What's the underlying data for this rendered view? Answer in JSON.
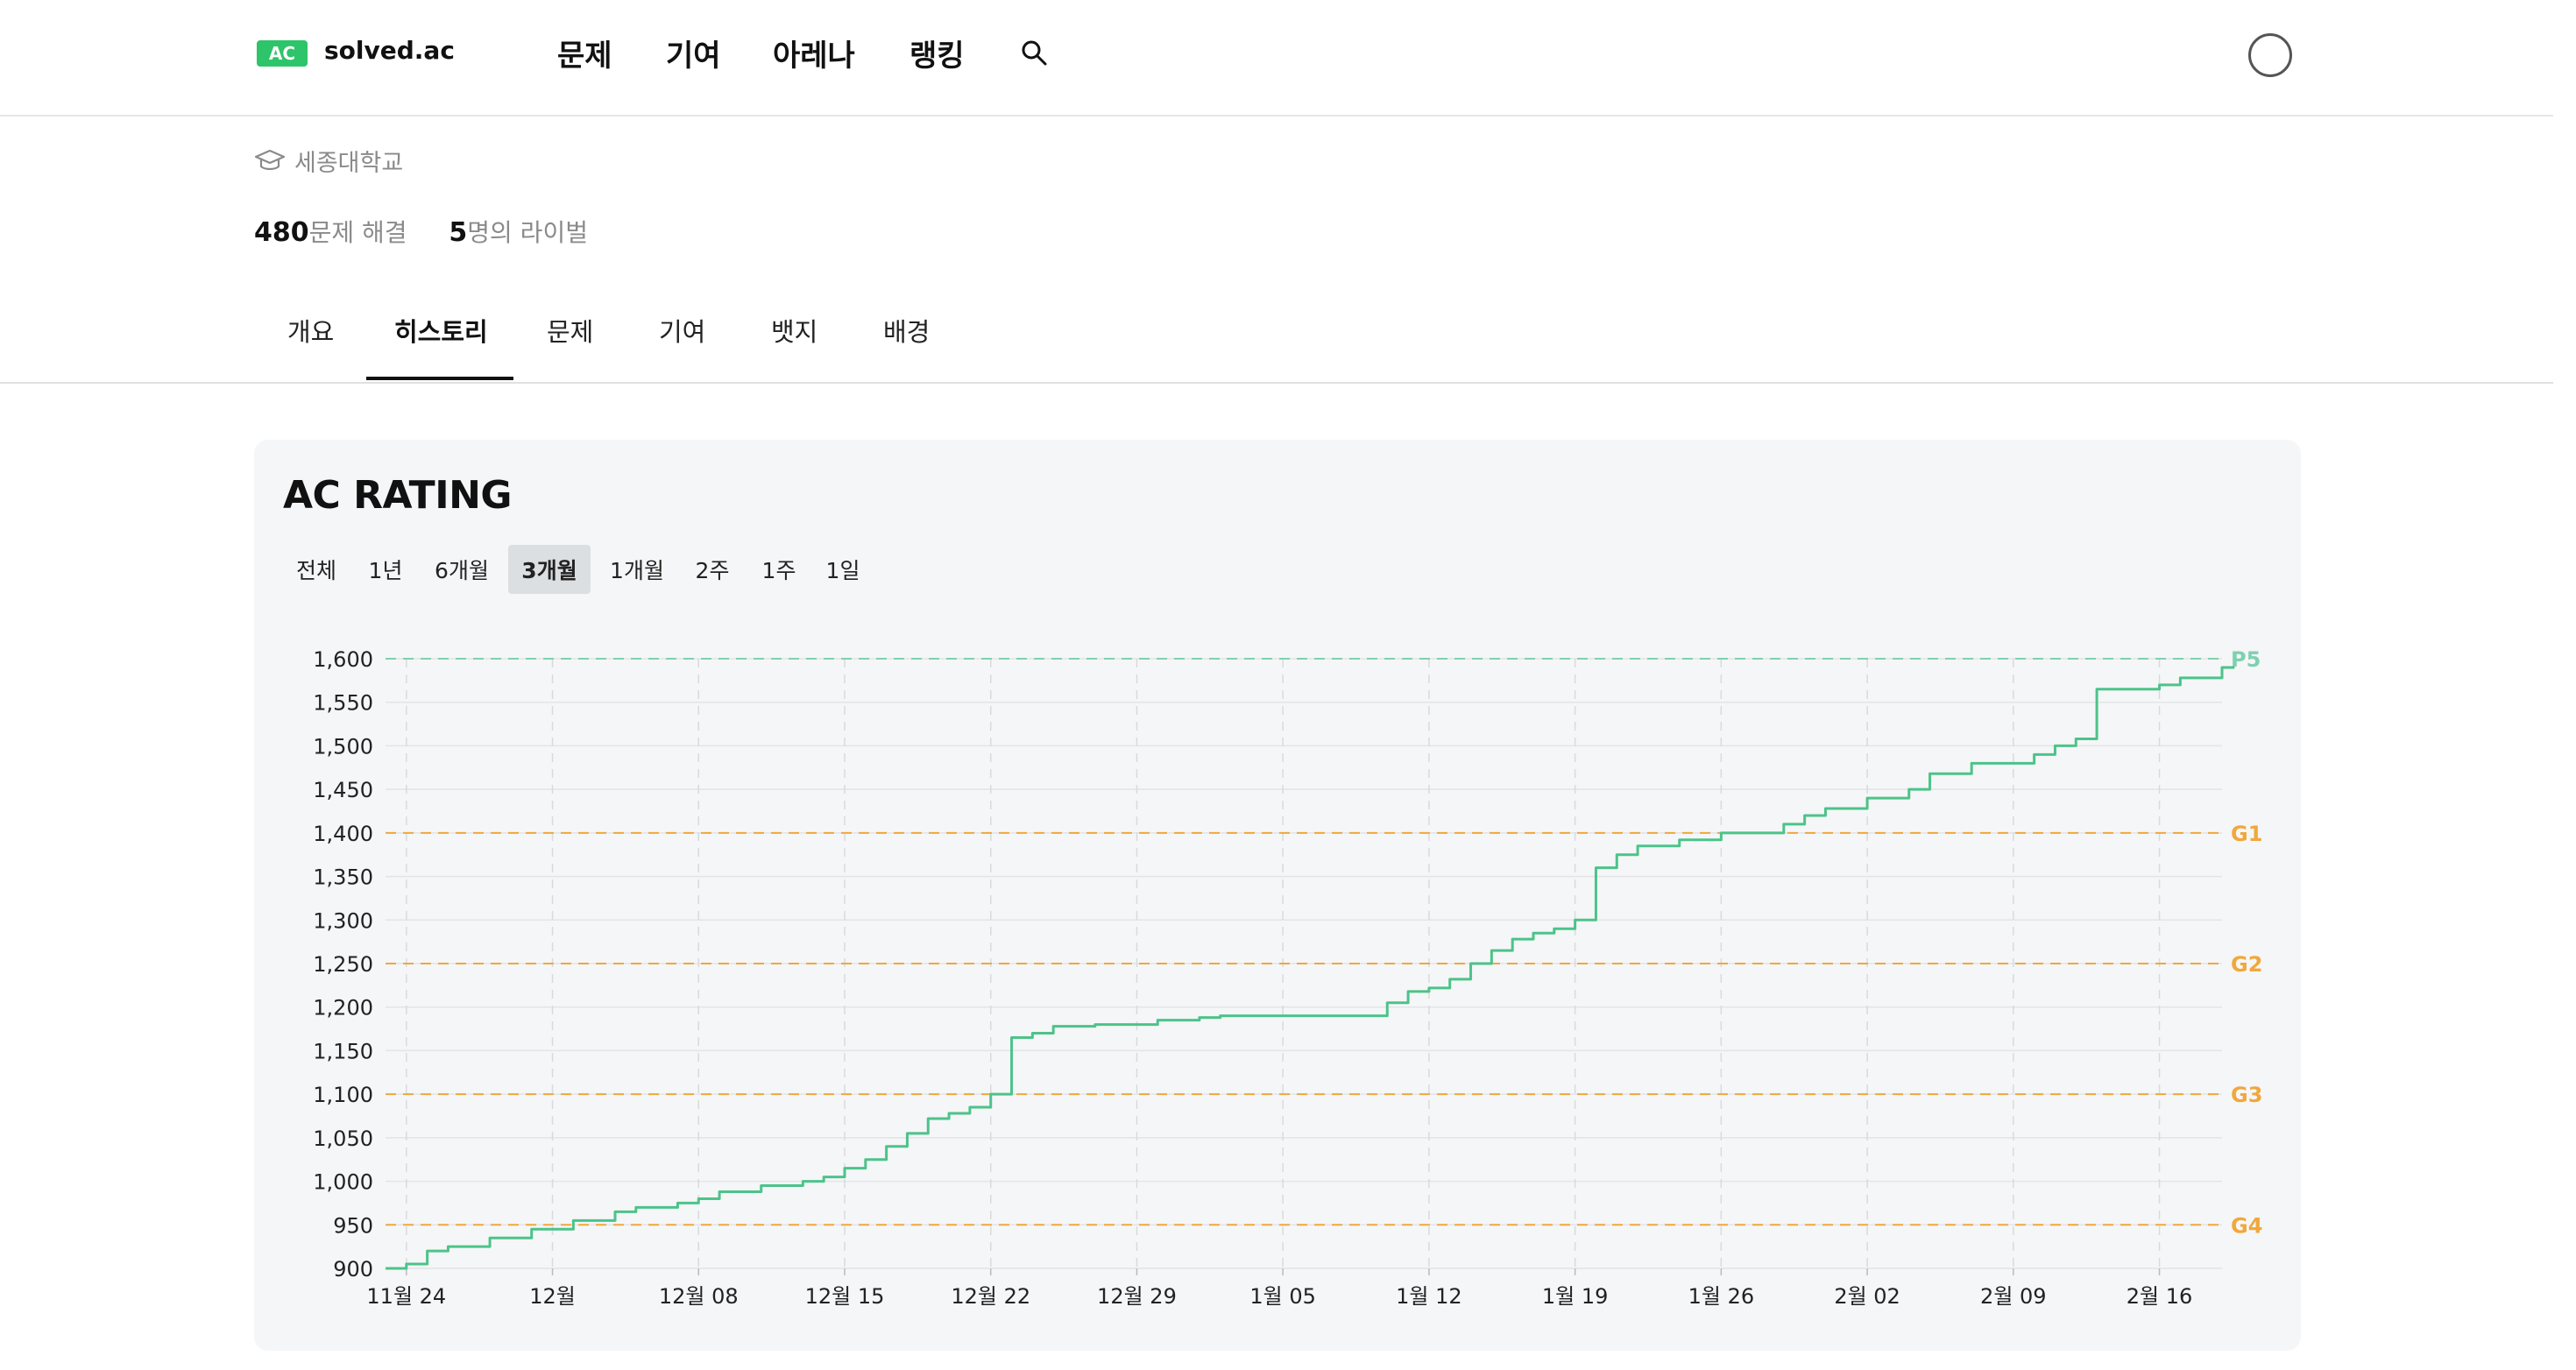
{
  "header": {
    "logo_badge": "AC",
    "logo_text": "solved.ac",
    "nav": [
      "문제",
      "기여",
      "아레나",
      "랭킹"
    ]
  },
  "profile": {
    "school": "세종대학교",
    "solved_count": "480",
    "solved_suffix": "문제 해결",
    "rival_count": "5",
    "rival_suffix": "명의 라이벌"
  },
  "tabs": [
    "개요",
    "히스토리",
    "문제",
    "기여",
    "뱃지",
    "배경"
  ],
  "active_tab": "히스토리",
  "card": {
    "title": "AC RATING",
    "ranges": [
      "전체",
      "1년",
      "6개월",
      "3개월",
      "1개월",
      "2주",
      "1주",
      "1일"
    ],
    "active_range": "3개월"
  },
  "colors": {
    "line": "#4cc38a",
    "platinum": "#7fd0b0",
    "gold": "#f0a83c",
    "grid": "#e2e4e6",
    "brand": "#2dc46a"
  },
  "chart_data": {
    "type": "line",
    "title": "AC RATING",
    "xlabel": "",
    "ylabel": "",
    "ylim": [
      900,
      1600
    ],
    "yticks": [
      "900",
      "950",
      "1,000",
      "1,050",
      "1,100",
      "1,150",
      "1,200",
      "1,250",
      "1,300",
      "1,350",
      "1,400",
      "1,450",
      "1,500",
      "1,550",
      "1,600"
    ],
    "xticks": [
      "11월 24",
      "12월",
      "12월 08",
      "12월 15",
      "12월 22",
      "12월 29",
      "1월 05",
      "1월 12",
      "1월 19",
      "1월 26",
      "2월 02",
      "2월 09",
      "2월 16"
    ],
    "tier_lines": [
      {
        "label": "P5",
        "value": 1600,
        "color": "#7fd0b0"
      },
      {
        "label": "G1",
        "value": 1400,
        "color": "#f0a83c"
      },
      {
        "label": "G2",
        "value": 1250,
        "color": "#f0a83c"
      },
      {
        "label": "G3",
        "value": 1100,
        "color": "#f0a83c"
      },
      {
        "label": "G4",
        "value": 950,
        "color": "#f0a83c"
      }
    ],
    "series": [
      {
        "x": [
          "11월 23",
          "11월 24",
          "11월 25",
          "11월 26",
          "11월 28",
          "11월 30",
          "12월 02",
          "12월 04",
          "12월 05",
          "12월 07",
          "12월 08",
          "12월 09",
          "12월 11",
          "12월 13",
          "12월 14",
          "12월 15",
          "12월 16",
          "12월 17",
          "12월 18",
          "12월 19",
          "12월 20",
          "12월 21",
          "12월 22",
          "12월 23",
          "12월 24",
          "12월 25",
          "12월 27",
          "12월 30",
          "1월 01",
          "1월 02",
          "1월 09",
          "1월 10",
          "1월 11",
          "1월 12",
          "1월 13",
          "1월 14",
          "1월 15",
          "1월 16",
          "1월 17",
          "1월 18",
          "1월 19",
          "1월 20",
          "1월 21",
          "1월 22",
          "1월 24",
          "1월 26",
          "1월 29",
          "1월 30",
          "1월 31",
          "2월 02",
          "2월 04",
          "2월 05",
          "2월 07",
          "2월 10",
          "2월 11",
          "2월 12",
          "2월 13",
          "2월 16",
          "2월 17",
          "2월 19"
        ],
        "values": [
          900,
          905,
          920,
          925,
          935,
          945,
          955,
          965,
          970,
          975,
          980,
          988,
          995,
          1000,
          1005,
          1015,
          1025,
          1040,
          1055,
          1072,
          1078,
          1085,
          1100,
          1165,
          1170,
          1178,
          1180,
          1185,
          1188,
          1190,
          1190,
          1205,
          1218,
          1222,
          1232,
          1250,
          1265,
          1278,
          1285,
          1290,
          1300,
          1360,
          1375,
          1385,
          1392,
          1400,
          1410,
          1420,
          1428,
          1440,
          1450,
          1468,
          1480,
          1490,
          1500,
          1508,
          1565,
          1570,
          1578,
          1590
        ]
      }
    ]
  }
}
